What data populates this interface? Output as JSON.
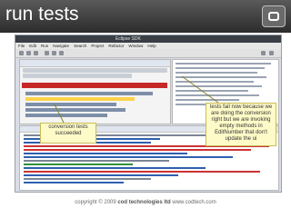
{
  "slide": {
    "title": "run tests",
    "footer_prefix": "copyright © 2009",
    "footer_company": "cod technologies ltd",
    "footer_url": "www.codtech.com"
  },
  "ide": {
    "window_title": "Eclipse SDK",
    "menu": [
      "File",
      "Edit",
      "Run",
      "Navigate",
      "Search",
      "Project",
      "Refactor",
      "Window",
      "Help"
    ]
  },
  "callouts": {
    "left": "conversion tests succeeded",
    "right": "tests fail now because we are doing the conversion right but we are invoking empty methods in EditNumber that don't update the ui"
  },
  "colors": {
    "title_bar": "#3a3a3a",
    "callout_bg": "#fefbc8",
    "failure_bar": "#c62828"
  }
}
